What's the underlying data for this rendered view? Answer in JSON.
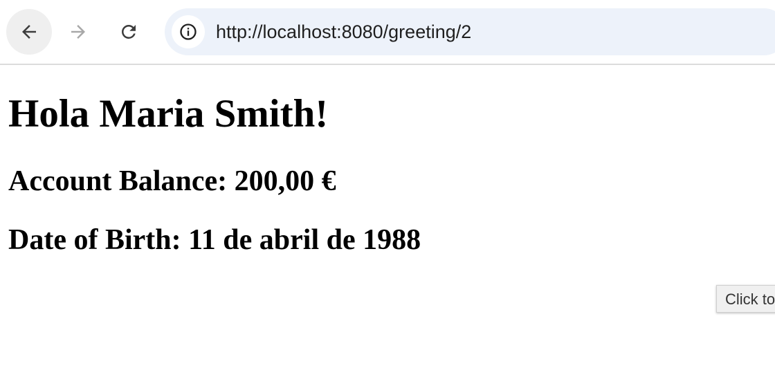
{
  "browser": {
    "url": "http://localhost:8080/greeting/2",
    "icons": {
      "back": "arrow-left-icon",
      "forward": "arrow-right-icon",
      "reload": "reload-icon",
      "site_info": "info-icon"
    }
  },
  "page": {
    "greeting": "Hola Maria Smith!",
    "balance_label": "Account Balance:",
    "balance_value": "200,00 €",
    "dob_label": "Date of Birth:",
    "dob_value": "11 de abril de 1988"
  },
  "hint": {
    "text": "Click to"
  },
  "colors": {
    "omnibox_bg": "#edf2fa",
    "back_button_bg": "#efefef",
    "text": "#000000"
  }
}
